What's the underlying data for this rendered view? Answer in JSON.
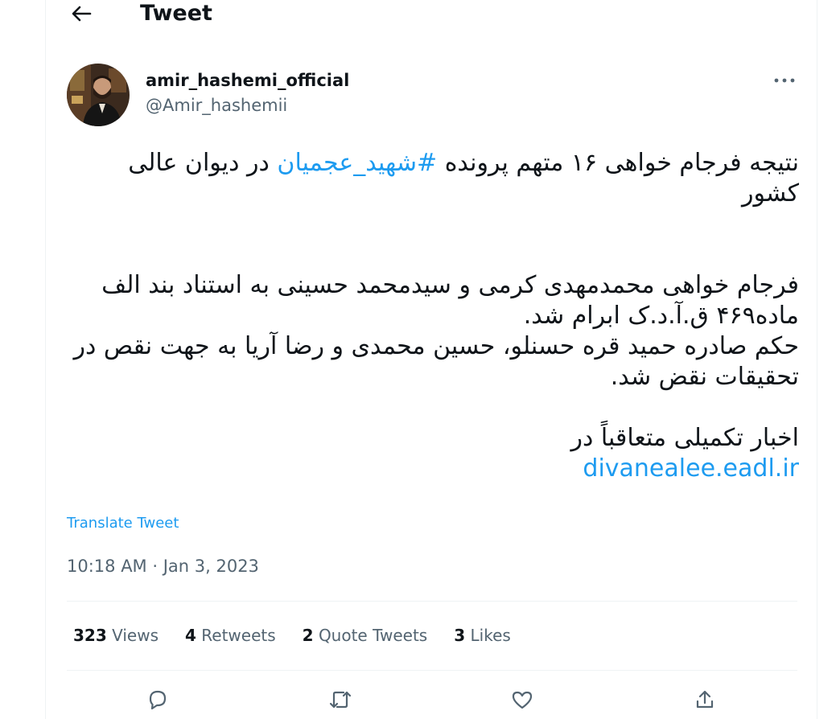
{
  "header": {
    "title": "Tweet",
    "back_icon": "arrow-left-icon"
  },
  "author": {
    "display_name": "amir_hashemi_official",
    "handle": "@Amir_hashemii",
    "avatar": "avatar-photo",
    "more_icon": "more-icon"
  },
  "tweet": {
    "line1_pre": "نتیجه فرجام خواهی ۱۶ متهم پرونده ",
    "hashtag": "#شهید_عجمیان",
    "line1_post": " در دیوان عالی کشور",
    "para2": "فرجام خواهی محمدمهدی کرمی و سیدمحمد حسینی به استناد بند الف ماده۴۶۹ ق.آ.د.ک ابرام شد.",
    "para3": "حکم صادره حمید قره حسنلو، حسین محمدی و رضا آریا به جهت نقص در تحقیقات نقض شد.",
    "para4": "اخبار تکمیلی متعاقباً در",
    "link": "divanealee.eadl.ir"
  },
  "translate_label": "Translate Tweet",
  "timestamp": {
    "time": "10:18 AM",
    "separator": " · ",
    "date": "Jan 3, 2023"
  },
  "stats": {
    "views_count": "323",
    "views_label": "Views",
    "retweets_count": "4",
    "retweets_label": "Retweets",
    "quotes_count": "2",
    "quotes_label": "Quote Tweets",
    "likes_count": "3",
    "likes_label": "Likes"
  },
  "actions": {
    "reply_icon": "reply-icon",
    "retweet_icon": "retweet-icon",
    "like_icon": "heart-icon",
    "share_icon": "share-icon"
  },
  "colors": {
    "accent": "#1d9bf0",
    "text": "#0f1419",
    "secondary": "#536471",
    "divider": "#eff3f4"
  }
}
